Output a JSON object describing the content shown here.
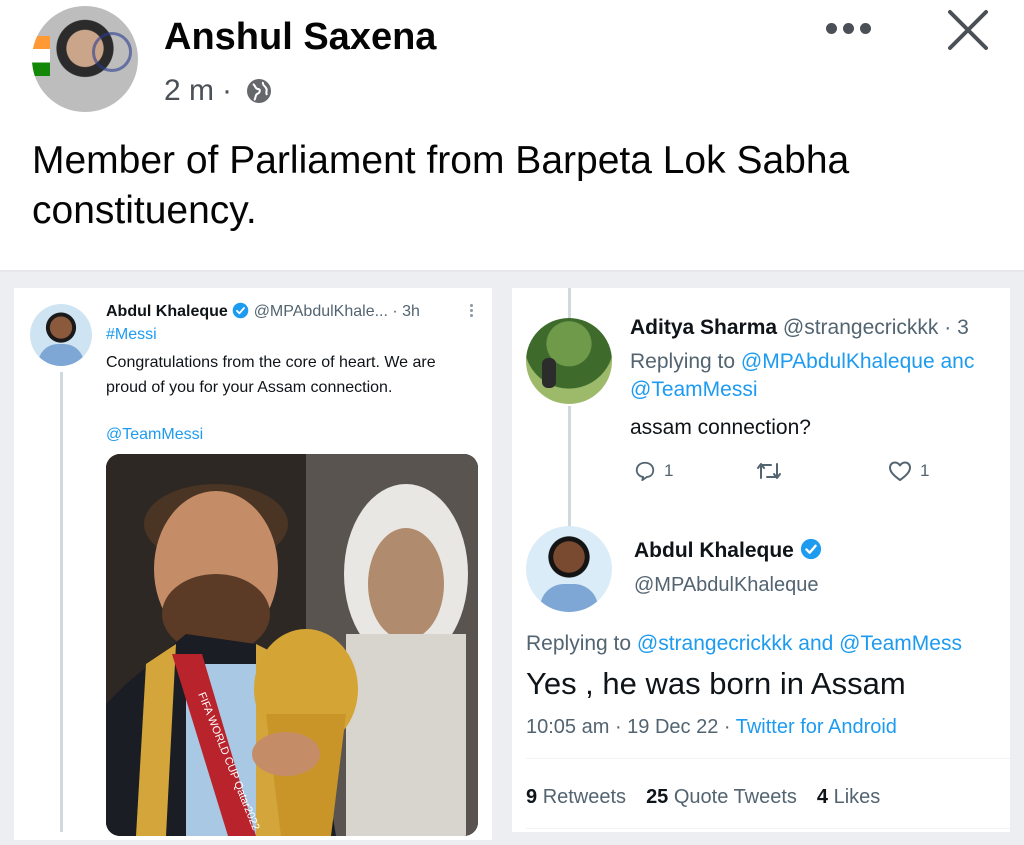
{
  "post": {
    "author_name": "Anshul Saxena",
    "time": "2 m",
    "separator": "·",
    "text": "Member of Parliament from Barpeta Lok Sabha constituency."
  },
  "tweet_left": {
    "name": "Abdul Khaleque",
    "handle": "@MPAbdulKhale...",
    "time": "· 3h",
    "hashtag": "#Messi",
    "body": "Congratulations from the core of heart. We are proud of you for your Assam connection.",
    "mention": "@TeamMessi",
    "photo_text": "FIFA WORLD CUP Qatar2022"
  },
  "tweet_reply": {
    "name": "Aditya Sharma",
    "handle": "@strangecrickkk · 3",
    "replying_prefix": "Replying to ",
    "replying_to_1": "@MPAbdulKhaleque anc",
    "replying_to_2": "@TeamMessi",
    "text": "assam connection?",
    "reply_count": "1",
    "like_count": "1"
  },
  "tweet_main": {
    "name": "Abdul Khaleque",
    "handle": "@MPAbdulKhaleque",
    "replying_prefix": "Replying to ",
    "replying_to": "@strangecrickkk and @TeamMess",
    "text": "Yes , he was born in Assam",
    "timestamp": "10:05 am · 19 Dec 22 · ",
    "source": "Twitter for Android",
    "retweets_count": "9",
    "retweets_label": "Retweets",
    "quotes_count": "25",
    "quotes_label": "Quote Tweets",
    "likes_count": "4",
    "likes_label": "Likes"
  },
  "icons": {
    "globe": "globe-icon",
    "more": "more-horizontal-icon",
    "close": "close-icon",
    "verified": "verified-badge-icon",
    "reply": "reply-bubble-icon",
    "retweet": "retweet-icon",
    "like": "heart-icon"
  },
  "colors": {
    "twitter_blue": "#1d9bf0",
    "fb_text": "#050505",
    "secondary": "#536471"
  }
}
